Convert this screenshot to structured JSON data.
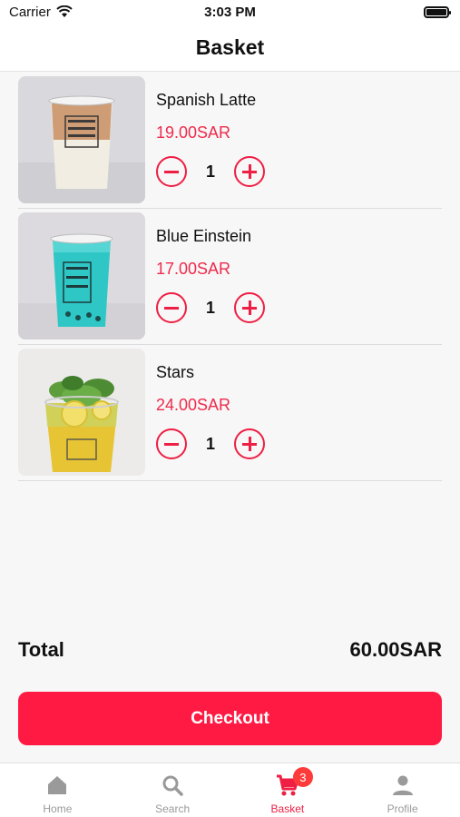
{
  "status_bar": {
    "carrier": "Carrier",
    "time": "3:03 PM"
  },
  "header": {
    "title": "Basket"
  },
  "items": [
    {
      "name": "Spanish Latte",
      "price": "19.00SAR",
      "quantity": "1",
      "image": "iced-latte-cup"
    },
    {
      "name": "Blue Einstein",
      "price": "17.00SAR",
      "quantity": "1",
      "image": "blue-drink-cup"
    },
    {
      "name": "Stars",
      "price": "24.00SAR",
      "quantity": "1",
      "image": "mint-lemon-drink-cup"
    }
  ],
  "summary": {
    "total_label": "Total",
    "total_value": "60.00SAR"
  },
  "checkout": {
    "label": "Checkout"
  },
  "tabs": [
    {
      "label": "Home",
      "icon": "home-icon"
    },
    {
      "label": "Search",
      "icon": "search-icon"
    },
    {
      "label": "Basket",
      "icon": "cart-icon",
      "badge": "3",
      "active": true
    },
    {
      "label": "Profile",
      "icon": "person-icon"
    }
  ],
  "colors": {
    "accent": "#fe1a43",
    "price": "#ee2b4c",
    "inactive_tab": "#9a9a9a"
  }
}
